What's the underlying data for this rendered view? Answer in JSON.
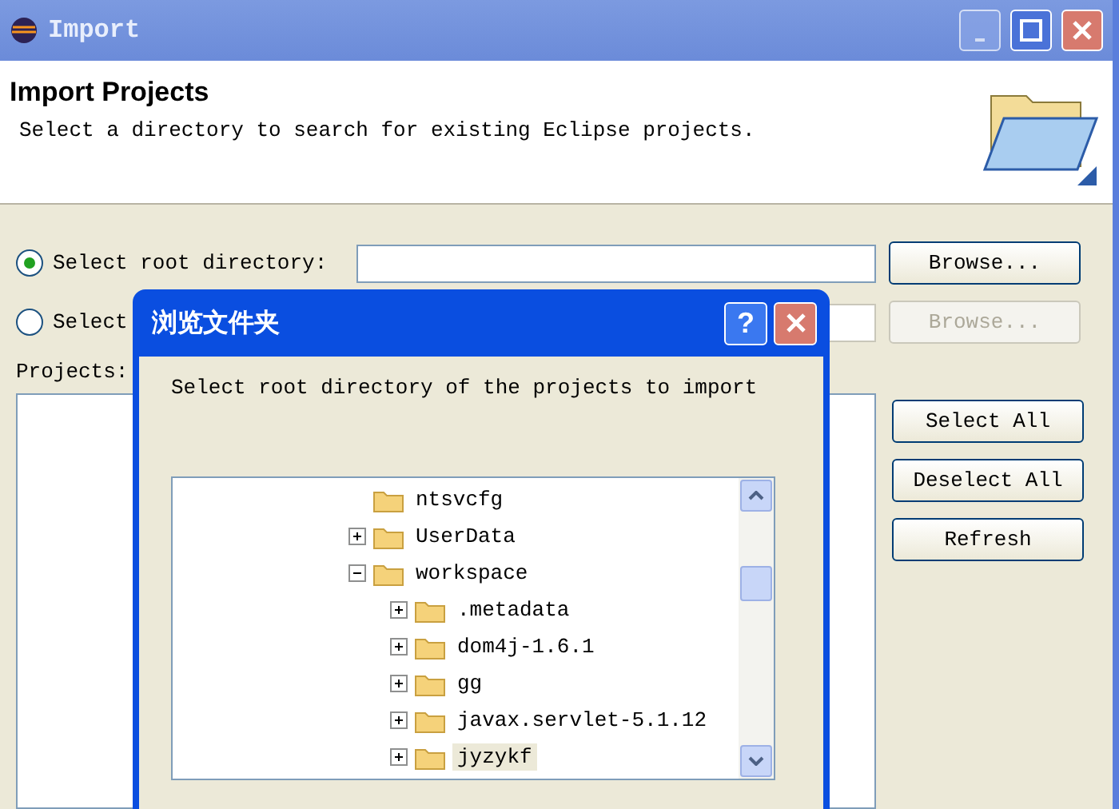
{
  "window": {
    "title": "Import"
  },
  "header": {
    "title": "Import Projects",
    "description": "Select a directory to search for existing Eclipse projects."
  },
  "sources": [
    {
      "label": "Select root directory:",
      "selected": true,
      "disabled": false,
      "button": "Browse..."
    },
    {
      "label": "Select",
      "selected": false,
      "disabled": true,
      "button": "Browse..."
    }
  ],
  "projects": {
    "label": "Projects:",
    "buttons": [
      "Select All",
      "Deselect All",
      "Refresh"
    ]
  },
  "dialog": {
    "title": "浏览文件夹",
    "help": "?",
    "message": "Select root directory of the projects to import",
    "tree": [
      {
        "label": "ntsvcfg",
        "kind": "leaf",
        "selected": false
      },
      {
        "label": "UserData",
        "kind": "branch",
        "expanded": false,
        "selected": false
      },
      {
        "label": "workspace",
        "kind": "branch",
        "expanded": true,
        "selected": false,
        "children": [
          {
            "label": ".metadata",
            "kind": "branch",
            "expanded": false,
            "selected": false
          },
          {
            "label": "dom4j-1.6.1",
            "kind": "branch",
            "expanded": false,
            "selected": false
          },
          {
            "label": "gg",
            "kind": "branch",
            "expanded": false,
            "selected": false
          },
          {
            "label": "javax.servlet-5.1.12",
            "kind": "branch",
            "expanded": false,
            "selected": false
          },
          {
            "label": "jyzykf",
            "kind": "branch",
            "expanded": false,
            "selected": true
          }
        ]
      }
    ]
  }
}
